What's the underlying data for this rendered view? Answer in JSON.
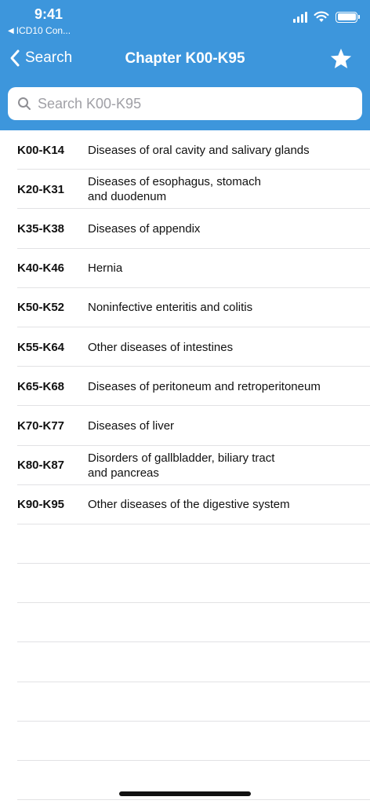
{
  "status": {
    "time": "9:41",
    "back_app": "ICD10 Con..."
  },
  "nav": {
    "back_label": "Search",
    "title": "Chapter K00-K95",
    "favorite_icon": "star-icon"
  },
  "search": {
    "placeholder": "Search K00-K95",
    "value": ""
  },
  "colors": {
    "header": "#3d96dc"
  },
  "rows": [
    {
      "code": "K00-K14",
      "description": "Diseases of oral cavity and salivary glands"
    },
    {
      "code": "K20-K31",
      "description": "Diseases of esophagus, stomach\nand duodenum"
    },
    {
      "code": "K35-K38",
      "description": "Diseases of appendix"
    },
    {
      "code": "K40-K46",
      "description": "Hernia"
    },
    {
      "code": "K50-K52",
      "description": "Noninfective enteritis and colitis"
    },
    {
      "code": "K55-K64",
      "description": "Other diseases of intestines"
    },
    {
      "code": "K65-K68",
      "description": "Diseases of peritoneum and retroperitoneum"
    },
    {
      "code": "K70-K77",
      "description": "Diseases of liver"
    },
    {
      "code": "K80-K87",
      "description": "Disorders of gallbladder, biliary tract\nand pancreas"
    },
    {
      "code": "K90-K95",
      "description": "Other diseases of the digestive system"
    }
  ]
}
